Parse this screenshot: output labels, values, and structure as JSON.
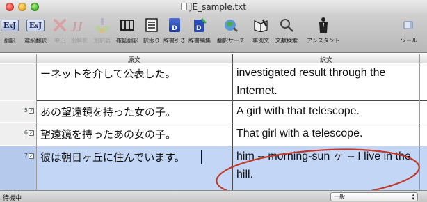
{
  "window": {
    "title": "JE_sample.txt"
  },
  "toolbar": {
    "buttons": [
      {
        "label": "翻訳",
        "icon": "ej-icon",
        "enabled": true
      },
      {
        "label": "選択翻訳",
        "icon": "ej-icon",
        "enabled": true
      },
      {
        "label": "中止",
        "icon": "stop-icon",
        "enabled": false
      },
      {
        "label": "別解釈",
        "icon": "alt-interpretation-icon",
        "enabled": false
      },
      {
        "label": "別訳語",
        "icon": "alt-word-icon",
        "enabled": false
      },
      {
        "label": "確認翻訳",
        "icon": "confirm-translate-icon",
        "enabled": true
      },
      {
        "label": "訳振り",
        "icon": "interlinear-icon",
        "enabled": true
      },
      {
        "label": "辞書引き",
        "icon": "dictionary-icon",
        "enabled": true
      },
      {
        "label": "辞書編集",
        "icon": "dictionary-edit-icon",
        "enabled": true
      },
      {
        "label": "翻訳サーチ",
        "icon": "translate-search-icon",
        "enabled": true
      },
      {
        "label": "事例文",
        "icon": "examples-icon",
        "enabled": true
      },
      {
        "label": "文献検索",
        "icon": "literature-search-icon",
        "enabled": true
      },
      {
        "label": "アシスタント",
        "icon": "assistant-icon",
        "enabled": true
      },
      {
        "label": "ツール",
        "icon": "tool-icon",
        "enabled": true
      }
    ]
  },
  "columns": {
    "source": "原文",
    "target": "訳文"
  },
  "rows": [
    {
      "num": "",
      "checked": false,
      "source": "ーネットを介して公表した。",
      "target": "investigated result through the Internet."
    },
    {
      "num": "5",
      "checked": true,
      "source": "あの望遠鏡を持った女の子。",
      "target": "A girl with that telescope."
    },
    {
      "num": "6",
      "checked": true,
      "source": "望遠鏡を持ったあの女の子。",
      "target": "That girl with a telescope."
    },
    {
      "num": "7",
      "checked": true,
      "source": "彼は朝日ヶ丘に住んでいます。",
      "target": "him -- morning-sun ヶ -- I live in the hill."
    }
  ],
  "status": {
    "text": "待機中",
    "mode_select": "一般"
  },
  "colors": {
    "selection": "#c3d6f5",
    "annotation": "#c0392b"
  }
}
